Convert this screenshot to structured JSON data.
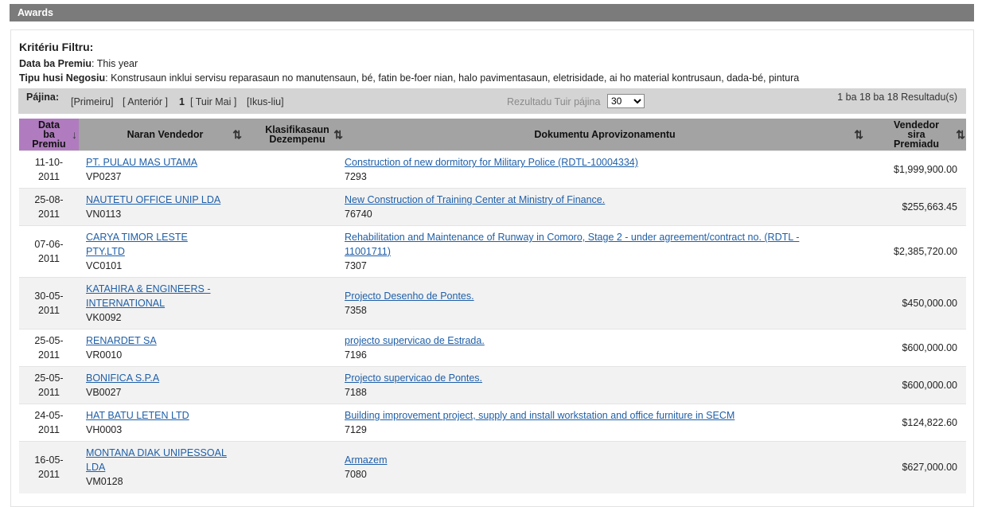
{
  "title": "Awards",
  "filter": {
    "heading": "Kritériu Filtru:",
    "date_label": "Data ba Premiu",
    "date_value": "This year",
    "business_label": "Tipu husi Negosiu",
    "business_value": "Konstrusaun inklui servisu reparasaun no manutensaun, bé, fatin be-foer nian, halo pavimentasaun, eletrisidade, ai ho material kontrusaun, dada-bé, pintura"
  },
  "pager": {
    "page_label": "Pájina:",
    "first": "[Primeiru]",
    "prev": "[ Anteriór ]",
    "current": "1",
    "next": "[ Tuir Mai ]",
    "last": "[Ikus-liu]",
    "per_page_label": "Rezultadu Tuir pájina",
    "per_page_value": "30",
    "count": "1 ba 18 ba 18 Resultadu(s)"
  },
  "columns": {
    "date": [
      "Data",
      "ba",
      "Premiu"
    ],
    "vendor": "Naran Vendedor",
    "classification": [
      "Klasifikasaun",
      "Dezempenu"
    ],
    "document": "Dokumentu Aprovizonamentu",
    "amount": [
      "Vendedor",
      "sira",
      "Premiadu"
    ]
  },
  "rows": [
    {
      "date": [
        "11-10-",
        "2011"
      ],
      "vendor": [
        "PT. PULAU MAS UTAMA"
      ],
      "vendor_id": "VP0237",
      "doc": [
        "Construction of new dormitory for Military Police (RDTL-10004334)"
      ],
      "doc_id": "7293",
      "amount": "$1,999,900.00"
    },
    {
      "date": [
        "25-08-",
        "2011"
      ],
      "vendor": [
        "NAUTETU OFFICE UNIP LDA"
      ],
      "vendor_id": "VN0113",
      "doc": [
        "New Construction of Training Center at Ministry of Finance."
      ],
      "doc_id": "76740",
      "amount": "$255,663.45"
    },
    {
      "date": [
        "07-06-",
        "2011"
      ],
      "vendor": [
        "CARYA TIMOR LESTE",
        "PTY.LTD"
      ],
      "vendor_id": "VC0101",
      "doc": [
        "Rehabilitation and Maintenance of Runway in Comoro, Stage 2 - under agreement/contract no. (RDTL -",
        "11001711)"
      ],
      "doc_id": "7307",
      "amount": "$2,385,720.00"
    },
    {
      "date": [
        "30-05-",
        "2011"
      ],
      "vendor": [
        "KATAHIRA & ENGINEERS -",
        "INTERNATIONAL"
      ],
      "vendor_id": "VK0092",
      "doc": [
        "Projecto Desenho de Pontes."
      ],
      "doc_id": "7358",
      "amount": "$450,000.00"
    },
    {
      "date": [
        "25-05-",
        "2011"
      ],
      "vendor": [
        "RENARDET SA"
      ],
      "vendor_id": "VR0010",
      "doc": [
        "projecto supervicao de Estrada."
      ],
      "doc_id": "7196",
      "amount": "$600,000.00"
    },
    {
      "date": [
        "25-05-",
        "2011"
      ],
      "vendor": [
        "BONIFICA S.P.A"
      ],
      "vendor_id": "VB0027",
      "doc": [
        "Projecto supervicao de Pontes."
      ],
      "doc_id": "7188",
      "amount": "$600,000.00"
    },
    {
      "date": [
        "24-05-",
        "2011"
      ],
      "vendor": [
        "HAT BATU LETEN LTD"
      ],
      "vendor_id": "VH0003",
      "doc": [
        "Building improvement project, supply and install workstation and office furniture in SECM"
      ],
      "doc_id": "7129",
      "amount": "$124,822.60"
    },
    {
      "date": [
        "16-05-",
        "2011"
      ],
      "vendor": [
        "MONTANA DIAK UNIPESSOAL",
        "LDA"
      ],
      "vendor_id": "VM0128",
      "doc": [
        "Armazem"
      ],
      "doc_id": "7080",
      "amount": "$627,000.00"
    }
  ],
  "colors": {
    "titlebar": "#7b7b7b",
    "header": "#a3a3a3",
    "active_header": "#b07cbf",
    "link": "#1f5fa8"
  },
  "icons": {
    "sort": "sort-updown-icon",
    "sorted_desc": "arrow-down-icon"
  }
}
